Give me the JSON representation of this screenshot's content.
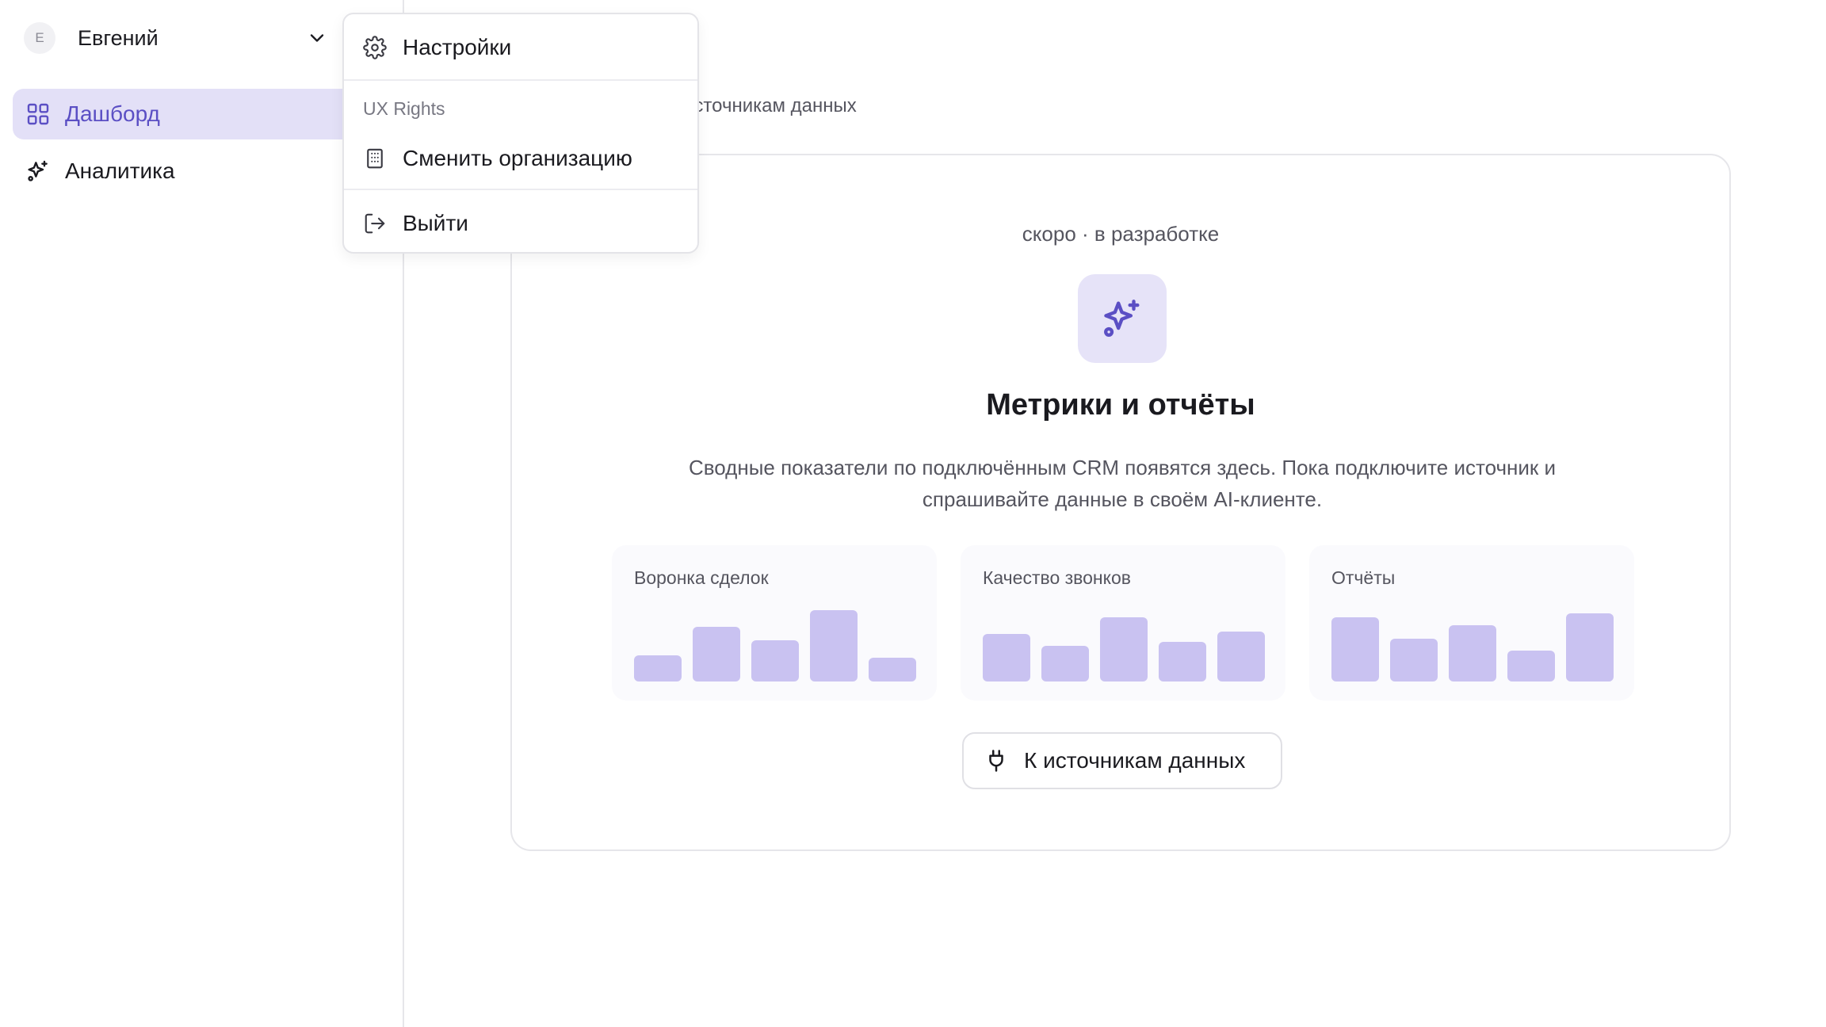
{
  "user": {
    "initial": "E",
    "name": "Евгений"
  },
  "sidebar": {
    "items": [
      {
        "label": "Дашборд",
        "icon": "grid-icon",
        "active": true
      },
      {
        "label": "Аналитика",
        "icon": "sparkles-icon",
        "active": false
      }
    ]
  },
  "breadcrumb": {
    "visible_text": "источникам данных"
  },
  "menu": {
    "settings_label": "Настройки",
    "group_label": "UX Rights",
    "switch_org_label": "Сменить организацию",
    "logout_label": "Выйти"
  },
  "main": {
    "status": "скоро · в разработке",
    "title": "Метрики и отчёты",
    "description": "Сводные показатели по подключённым CRM появятся здесь. Пока подключите источник и спрашивайте данные в своём AI-клиенте.",
    "tiles": [
      {
        "title": "Воронка сделок",
        "bars": [
          0.22,
          0.46,
          0.35,
          0.6,
          0.2
        ]
      },
      {
        "title": "Качество звонков",
        "bars": [
          0.4,
          0.3,
          0.54,
          0.33,
          0.42
        ]
      },
      {
        "title": "Отчёты",
        "bars": [
          0.54,
          0.36,
          0.47,
          0.26,
          0.57
        ]
      }
    ],
    "cta_label": "К источникам данных"
  },
  "colors": {
    "accent": "#5b4fc4",
    "active_bg": "#e3e0f7",
    "bar": "#c9c2f1",
    "hero_icon_bg": "#e6e3f8"
  }
}
